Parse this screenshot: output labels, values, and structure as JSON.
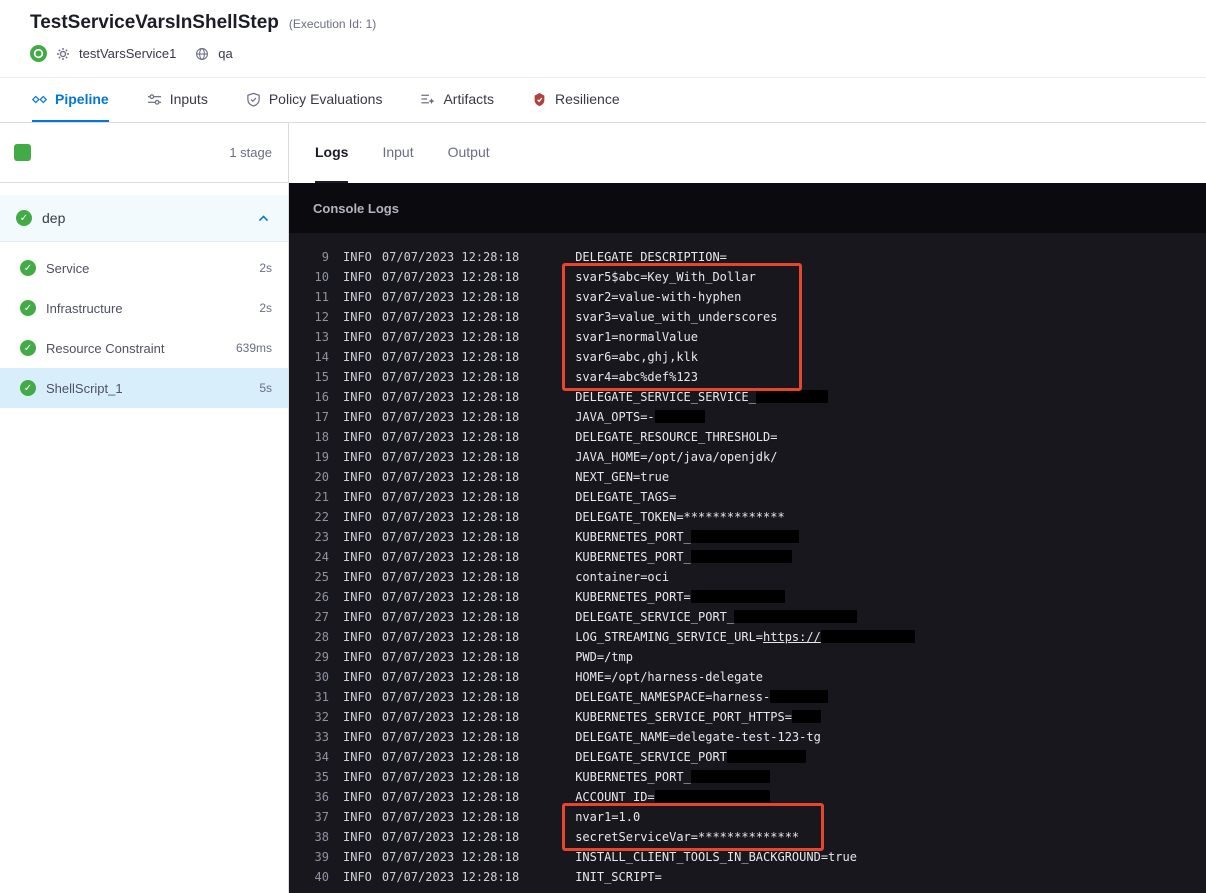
{
  "header": {
    "title": "TestServiceVarsInShellStep",
    "execution_id": "(Execution Id: 1)",
    "service_name": "testVarsService1",
    "environment_name": "qa"
  },
  "nav_tabs": [
    {
      "label": "Pipeline",
      "icon": "pipeline-icon",
      "active": true
    },
    {
      "label": "Inputs",
      "icon": "inputs-icon",
      "active": false
    },
    {
      "label": "Policy Evaluations",
      "icon": "policy-evaluations-icon",
      "active": false
    },
    {
      "label": "Artifacts",
      "icon": "artifacts-icon",
      "active": false
    },
    {
      "label": "Resilience",
      "icon": "resilience-icon",
      "active": false,
      "icon_color": "#b0413e"
    }
  ],
  "sidebar": {
    "stage_count": "1 stage",
    "stage_name": "dep",
    "steps": [
      {
        "name": "Service",
        "duration": "2s",
        "selected": false
      },
      {
        "name": "Infrastructure",
        "duration": "2s",
        "selected": false
      },
      {
        "name": "Resource Constraint",
        "duration": "639ms",
        "selected": false
      },
      {
        "name": "ShellScript_1",
        "duration": "5s",
        "selected": true
      }
    ]
  },
  "log_tabs": [
    {
      "label": "Logs",
      "active": true
    },
    {
      "label": "Input",
      "active": false
    },
    {
      "label": "Output",
      "active": false
    }
  ],
  "console": {
    "title": "Console Logs",
    "highlight_color": "#e8452f",
    "highlights": [
      {
        "from": 10,
        "to": 15
      },
      {
        "from": 37,
        "to": 38
      }
    ],
    "lines": [
      {
        "n": 9,
        "level": "INFO",
        "time": "07/07/2023 12:28:18",
        "parts": [
          {
            "t": "DELEGATE_DESCRIPTION="
          }
        ]
      },
      {
        "n": 10,
        "level": "INFO",
        "time": "07/07/2023 12:28:18",
        "parts": [
          {
            "t": "svar5$abc=Key_With_Dollar"
          }
        ]
      },
      {
        "n": 11,
        "level": "INFO",
        "time": "07/07/2023 12:28:18",
        "parts": [
          {
            "t": "svar2=value-with-hyphen"
          }
        ]
      },
      {
        "n": 12,
        "level": "INFO",
        "time": "07/07/2023 12:28:18",
        "parts": [
          {
            "t": "svar3=value_with_underscores"
          }
        ]
      },
      {
        "n": 13,
        "level": "INFO",
        "time": "07/07/2023 12:28:18",
        "parts": [
          {
            "t": "svar1=normalValue"
          }
        ]
      },
      {
        "n": 14,
        "level": "INFO",
        "time": "07/07/2023 12:28:18",
        "parts": [
          {
            "t": "svar6=abc,ghj,klk"
          }
        ]
      },
      {
        "n": 15,
        "level": "INFO",
        "time": "07/07/2023 12:28:18",
        "parts": [
          {
            "t": "svar4=abc%def%123"
          }
        ]
      },
      {
        "n": 16,
        "level": "INFO",
        "time": "07/07/2023 12:28:18",
        "parts": [
          {
            "t": "DELEGATE_SERVICE_SERVICE_"
          },
          {
            "r": 10
          }
        ]
      },
      {
        "n": 17,
        "level": "INFO",
        "time": "07/07/2023 12:28:18",
        "parts": [
          {
            "t": "JAVA_OPTS=-"
          },
          {
            "r": 7
          }
        ]
      },
      {
        "n": 18,
        "level": "INFO",
        "time": "07/07/2023 12:28:18",
        "parts": [
          {
            "t": "DELEGATE_RESOURCE_THRESHOLD="
          }
        ]
      },
      {
        "n": 19,
        "level": "INFO",
        "time": "07/07/2023 12:28:18",
        "parts": [
          {
            "t": "JAVA_HOME=/opt/java/openjdk/"
          }
        ]
      },
      {
        "n": 20,
        "level": "INFO",
        "time": "07/07/2023 12:28:18",
        "parts": [
          {
            "t": "NEXT_GEN=true"
          }
        ]
      },
      {
        "n": 21,
        "level": "INFO",
        "time": "07/07/2023 12:28:18",
        "parts": [
          {
            "t": "DELEGATE_TAGS="
          }
        ]
      },
      {
        "n": 22,
        "level": "INFO",
        "time": "07/07/2023 12:28:18",
        "parts": [
          {
            "t": "DELEGATE_TOKEN=**************"
          }
        ]
      },
      {
        "n": 23,
        "level": "INFO",
        "time": "07/07/2023 12:28:18",
        "parts": [
          {
            "t": "KUBERNETES_PORT_"
          },
          {
            "r": 15
          }
        ]
      },
      {
        "n": 24,
        "level": "INFO",
        "time": "07/07/2023 12:28:18",
        "parts": [
          {
            "t": "KUBERNETES_PORT_"
          },
          {
            "r": 14
          }
        ]
      },
      {
        "n": 25,
        "level": "INFO",
        "time": "07/07/2023 12:28:18",
        "parts": [
          {
            "t": "container=oci"
          }
        ]
      },
      {
        "n": 26,
        "level": "INFO",
        "time": "07/07/2023 12:28:18",
        "parts": [
          {
            "t": "KUBERNETES_PORT="
          },
          {
            "r": 13
          }
        ]
      },
      {
        "n": 27,
        "level": "INFO",
        "time": "07/07/2023 12:28:18",
        "parts": [
          {
            "t": "DELEGATE_SERVICE_PORT_"
          },
          {
            "r": 17
          }
        ]
      },
      {
        "n": 28,
        "level": "INFO",
        "time": "07/07/2023 12:28:18",
        "parts": [
          {
            "t": "LOG_STREAMING_SERVICE_URL="
          },
          {
            "t": "https://",
            "u": true
          },
          {
            "r": 13
          }
        ]
      },
      {
        "n": 29,
        "level": "INFO",
        "time": "07/07/2023 12:28:18",
        "parts": [
          {
            "t": "PWD=/tmp"
          }
        ]
      },
      {
        "n": 30,
        "level": "INFO",
        "time": "07/07/2023 12:28:18",
        "parts": [
          {
            "t": "HOME=/opt/harness-delegate"
          }
        ]
      },
      {
        "n": 31,
        "level": "INFO",
        "time": "07/07/2023 12:28:18",
        "parts": [
          {
            "t": "DELEGATE_NAMESPACE=harness-"
          },
          {
            "r": 8
          }
        ]
      },
      {
        "n": 32,
        "level": "INFO",
        "time": "07/07/2023 12:28:18",
        "parts": [
          {
            "t": "KUBERNETES_SERVICE_PORT_HTTPS="
          },
          {
            "r": 4
          }
        ]
      },
      {
        "n": 33,
        "level": "INFO",
        "time": "07/07/2023 12:28:18",
        "parts": [
          {
            "t": "DELEGATE_NAME=delegate-test-123-tg"
          }
        ]
      },
      {
        "n": 34,
        "level": "INFO",
        "time": "07/07/2023 12:28:18",
        "parts": [
          {
            "t": "DELEGATE_SERVICE_PORT"
          },
          {
            "r": 11
          }
        ]
      },
      {
        "n": 35,
        "level": "INFO",
        "time": "07/07/2023 12:28:18",
        "parts": [
          {
            "t": "KUBERNETES_PORT_"
          },
          {
            "r": 11
          }
        ]
      },
      {
        "n": 36,
        "level": "INFO",
        "time": "07/07/2023 12:28:18",
        "parts": [
          {
            "t": "ACCOUNT_ID="
          },
          {
            "r": 16
          }
        ]
      },
      {
        "n": 37,
        "level": "INFO",
        "time": "07/07/2023 12:28:18",
        "parts": [
          {
            "t": "nvar1=1.0"
          }
        ]
      },
      {
        "n": 38,
        "level": "INFO",
        "time": "07/07/2023 12:28:18",
        "parts": [
          {
            "t": "secretServiceVar=**************"
          }
        ]
      },
      {
        "n": 39,
        "level": "INFO",
        "time": "07/07/2023 12:28:18",
        "parts": [
          {
            "t": "INSTALL_CLIENT_TOOLS_IN_BACKGROUND=true"
          }
        ]
      },
      {
        "n": 40,
        "level": "INFO",
        "time": "07/07/2023 12:28:18",
        "parts": [
          {
            "t": "INIT_SCRIPT="
          }
        ]
      }
    ]
  },
  "colors": {
    "accent_blue": "#0278d5",
    "success_green": "#42ab45",
    "highlight_red": "#e8452f",
    "console_bg": "#17171d",
    "console_header_bg": "#0b0b0f",
    "selected_step_bg": "#d9eefb"
  }
}
